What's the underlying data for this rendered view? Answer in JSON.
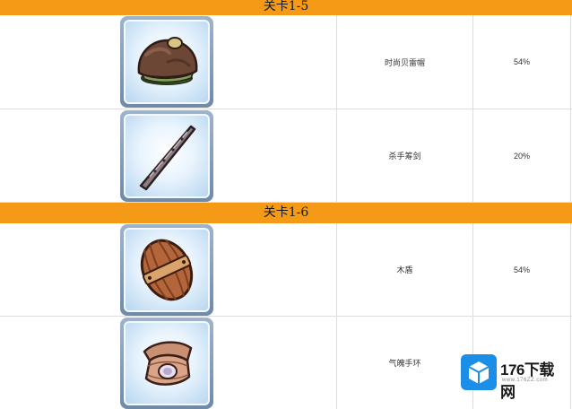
{
  "stages": [
    {
      "title": "关卡1-5",
      "items": [
        {
          "name": "时尚贝雷帽",
          "rate": "54%",
          "icon": "beret-icon"
        },
        {
          "name": "杀手筹剑",
          "rate": "20%",
          "icon": "thin-sword-icon"
        }
      ]
    },
    {
      "title": "关卡1-6",
      "items": [
        {
          "name": "木盾",
          "rate": "54%",
          "icon": "wooden-shield-icon"
        },
        {
          "name": "气魄手环",
          "rate": "",
          "icon": "bracelet-icon"
        }
      ]
    }
  ],
  "watermark": {
    "title": "176下载网",
    "url": "www.176ZZ.com",
    "logo_color": "#1b8ee8"
  },
  "colors": {
    "header_bg": "#f49a16",
    "card_border": "#7d98b5",
    "card_bg": "#e9f4fd"
  }
}
